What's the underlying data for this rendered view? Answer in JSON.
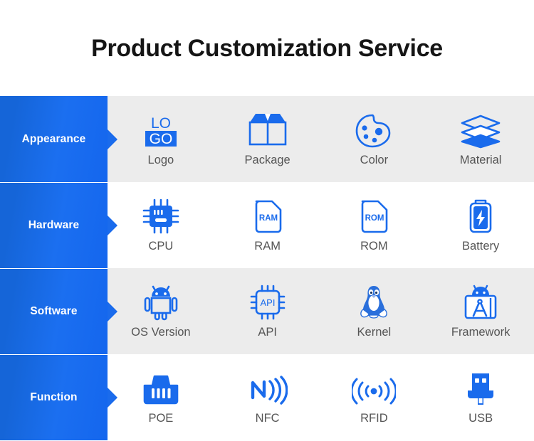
{
  "header": {
    "title": "Product Customization Service"
  },
  "colors": {
    "brand_blue": "#1a6bec",
    "label_gradient_start": "#1565d8",
    "label_gradient_end": "#1466ee",
    "row_shade_bg": "#ececec",
    "row_plain_bg": "#ffffff",
    "cell_label_text": "#555555",
    "title_text": "#151515"
  },
  "rows": [
    {
      "label": "Appearance",
      "shaded": true,
      "cells": [
        {
          "label": "Logo",
          "icon": "logo-icon"
        },
        {
          "label": "Package",
          "icon": "package-box-icon"
        },
        {
          "label": "Color",
          "icon": "color-palette-icon"
        },
        {
          "label": "Material",
          "icon": "material-layers-icon"
        }
      ]
    },
    {
      "label": "Hardware",
      "shaded": false,
      "cells": [
        {
          "label": "CPU",
          "icon": "cpu-chip-icon"
        },
        {
          "label": "RAM",
          "icon": "ram-card-icon"
        },
        {
          "label": "ROM",
          "icon": "rom-card-icon"
        },
        {
          "label": "Battery",
          "icon": "battery-bolt-icon"
        }
      ]
    },
    {
      "label": "Software",
      "shaded": true,
      "cells": [
        {
          "label": "OS Version",
          "icon": "android-robot-icon"
        },
        {
          "label": "API",
          "icon": "api-chip-icon"
        },
        {
          "label": "Kernel",
          "icon": "linux-penguin-icon"
        },
        {
          "label": "Framework",
          "icon": "framework-compass-icon"
        }
      ]
    },
    {
      "label": "Function",
      "shaded": false,
      "cells": [
        {
          "label": "POE",
          "icon": "ethernet-port-icon"
        },
        {
          "label": "NFC",
          "icon": "nfc-wave-icon"
        },
        {
          "label": "RFID",
          "icon": "rfid-signal-icon"
        },
        {
          "label": "USB",
          "icon": "usb-plug-icon"
        }
      ]
    }
  ],
  "icon_text": {
    "logo_top": "LO",
    "logo_bottom": "GO",
    "ram": "RAM",
    "rom": "ROM",
    "api": "API"
  }
}
